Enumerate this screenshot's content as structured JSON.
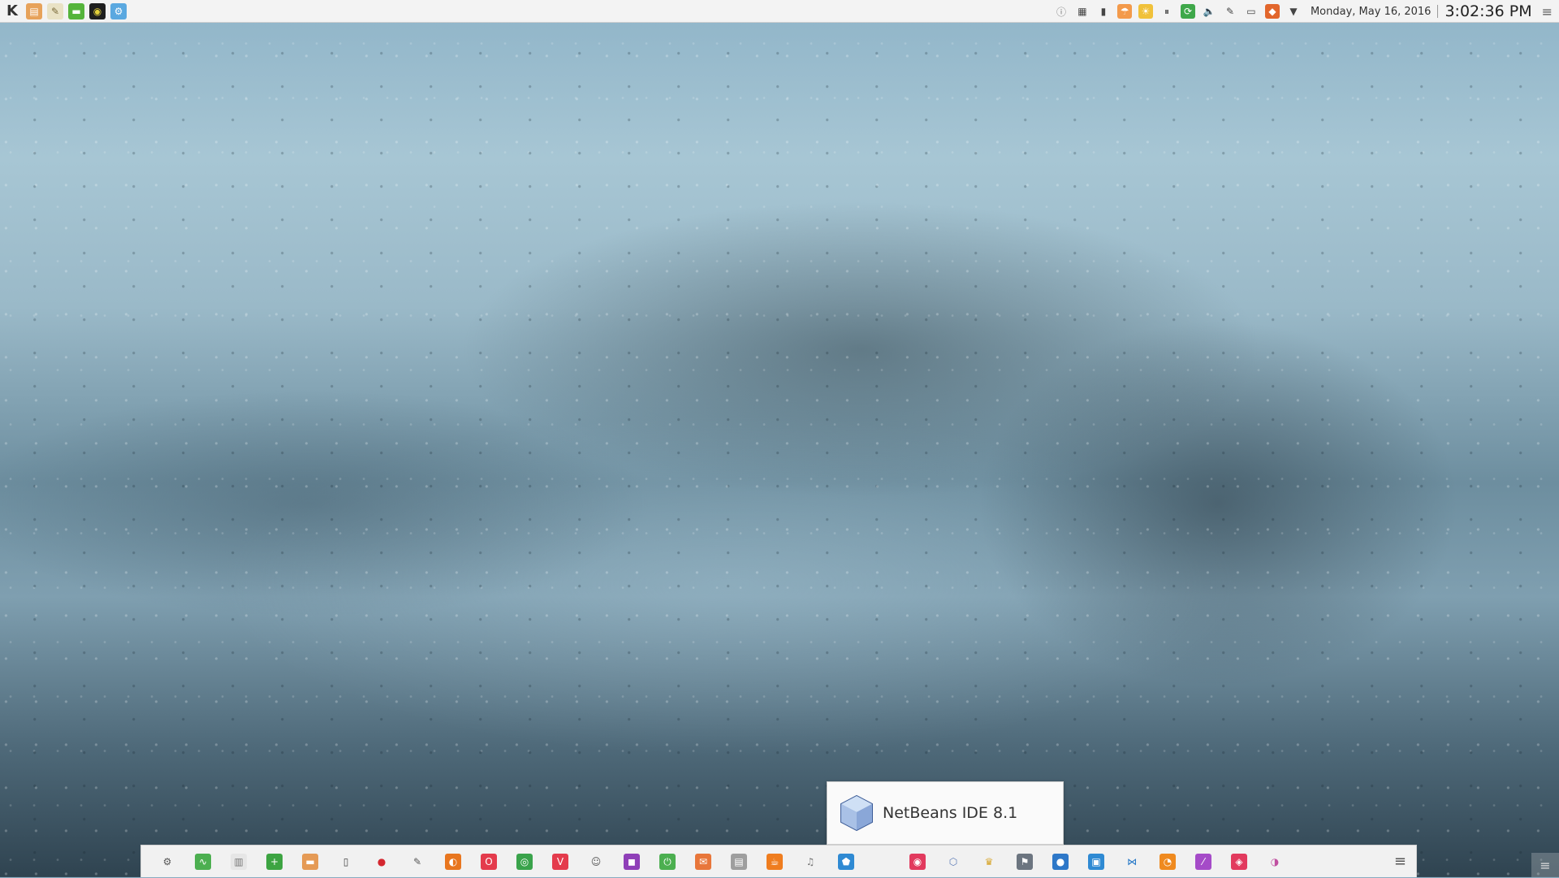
{
  "top_panel": {
    "left_icons": [
      {
        "name": "kde-launcher-icon",
        "glyph": "K",
        "bg": "transparent",
        "fg": "#333333"
      },
      {
        "name": "file-manager-icon",
        "glyph": "▤",
        "bg": "#e7a25a",
        "fg": "#ffffff"
      },
      {
        "name": "notes-icon",
        "glyph": "✎",
        "bg": "#e9e2c5",
        "fg": "#7a6a3a"
      },
      {
        "name": "terminal-icon",
        "glyph": "▬",
        "bg": "#55b43b",
        "fg": "#ffffff"
      },
      {
        "name": "web-browser-icon",
        "glyph": "◉",
        "bg": "#1f1f1f",
        "fg": "#e3d03a"
      },
      {
        "name": "system-settings-icon",
        "glyph": "⚙",
        "bg": "#5aa8e0",
        "fg": "#ffffff"
      }
    ],
    "tray_icons": [
      {
        "name": "info-icon",
        "glyph": "ⓘ",
        "fg": "#777777",
        "bg": "transparent"
      },
      {
        "name": "clipboard-icon",
        "glyph": "▦",
        "fg": "#444444",
        "bg": "transparent"
      },
      {
        "name": "usb-drive-icon",
        "glyph": "▮",
        "fg": "#444444",
        "bg": "transparent"
      },
      {
        "name": "weather-icon",
        "glyph": "☂",
        "fg": "#ffffff",
        "bg": "#f39a4b"
      },
      {
        "name": "sun-cloud-icon",
        "glyph": "☀",
        "fg": "#ffffff",
        "bg": "#f0c13a"
      },
      {
        "name": "media-pause-icon",
        "glyph": "⏸",
        "fg": "#444444",
        "bg": "transparent"
      },
      {
        "name": "update-icon",
        "glyph": "⟳",
        "fg": "#ffffff",
        "bg": "#3fa84a"
      },
      {
        "name": "volume-icon",
        "glyph": "🔈",
        "fg": "#444444",
        "bg": "transparent"
      },
      {
        "name": "pen-icon",
        "glyph": "✎",
        "fg": "#444444",
        "bg": "transparent"
      },
      {
        "name": "display-icon",
        "glyph": "▭",
        "fg": "#444444",
        "bg": "transparent"
      },
      {
        "name": "firewall-icon",
        "glyph": "◆",
        "fg": "#ffffff",
        "bg": "#e2662c"
      },
      {
        "name": "expand-tray-icon",
        "glyph": "▼",
        "fg": "#444444",
        "bg": "transparent"
      }
    ],
    "date": "Monday, May 16, 2016",
    "time": "3:02:36 PM",
    "menu_glyph": "≡"
  },
  "tooltip": {
    "text": "NetBeans IDE 8.1"
  },
  "dock": {
    "items": [
      {
        "name": "settings-icon",
        "glyph": "⚙",
        "bg": "transparent",
        "fg": "#555555"
      },
      {
        "name": "system-monitor-icon",
        "glyph": "∿",
        "bg": "#4caf50",
        "fg": "#ffffff"
      },
      {
        "name": "panel-icon",
        "glyph": "▥",
        "bg": "#e6e6e6",
        "fg": "#777777"
      },
      {
        "name": "spreadsheet-icon",
        "glyph": "+",
        "bg": "#3da442",
        "fg": "#ffffff"
      },
      {
        "name": "folder-icon",
        "glyph": "▬",
        "bg": "#e59a55",
        "fg": "#ffffff"
      },
      {
        "name": "text-document-icon",
        "glyph": "▯",
        "bg": "transparent",
        "fg": "#444444"
      },
      {
        "name": "cherry-icon",
        "glyph": "●",
        "bg": "transparent",
        "fg": "#d4272f"
      },
      {
        "name": "text-editor-icon",
        "glyph": "✎",
        "bg": "transparent",
        "fg": "#555555"
      },
      {
        "name": "firefox-icon",
        "glyph": "◐",
        "bg": "#e8761f",
        "fg": "#ffffff"
      },
      {
        "name": "opera-icon",
        "glyph": "O",
        "bg": "#e43b4c",
        "fg": "#ffffff"
      },
      {
        "name": "chrome-icon",
        "glyph": "◎",
        "bg": "#3aa34b",
        "fg": "#ffffff"
      },
      {
        "name": "vivaldi-icon",
        "glyph": "V",
        "bg": "#e43b4c",
        "fg": "#ffffff"
      },
      {
        "name": "pidgin-icon",
        "glyph": "☺",
        "bg": "transparent",
        "fg": "#555555"
      },
      {
        "name": "chat-icon",
        "glyph": "◼",
        "bg": "#8f3fb8",
        "fg": "#ffffff"
      },
      {
        "name": "power-icon",
        "glyph": "⏻",
        "bg": "#4caf50",
        "fg": "#ffffff"
      },
      {
        "name": "mail-icon",
        "glyph": "✉",
        "bg": "#e8763a",
        "fg": "#ffffff"
      },
      {
        "name": "archive-icon",
        "glyph": "▤",
        "bg": "#9e9e9e",
        "fg": "#ffffff"
      },
      {
        "name": "java-icon",
        "glyph": "☕",
        "bg": "#ef7d1f",
        "fg": "#ffffff"
      },
      {
        "name": "music-icon",
        "glyph": "♫",
        "bg": "transparent",
        "fg": "#777777"
      },
      {
        "name": "shield-icon",
        "glyph": "⬟",
        "bg": "#2f8ad3",
        "fg": "#ffffff"
      },
      {
        "name": "spacer-a",
        "glyph": "",
        "bg": "transparent",
        "fg": "#ffffff"
      },
      {
        "name": "screenshot-icon",
        "glyph": "◉",
        "bg": "#e23a5e",
        "fg": "#ffffff"
      },
      {
        "name": "netbeans-icon",
        "glyph": "⬡",
        "bg": "transparent",
        "fg": "#5a79b5"
      },
      {
        "name": "game-icon",
        "glyph": "♛",
        "bg": "transparent",
        "fg": "#d7a52a"
      },
      {
        "name": "bookmark-icon",
        "glyph": "⚑",
        "bg": "#6c7580",
        "fg": "#ffffff"
      },
      {
        "name": "globe-icon",
        "glyph": "●",
        "bg": "#2e78c8",
        "fg": "#ffffff"
      },
      {
        "name": "window-icon",
        "glyph": "▣",
        "bg": "#2f8ad3",
        "fg": "#ffffff"
      },
      {
        "name": "vscode-icon",
        "glyph": "⋈",
        "bg": "transparent",
        "fg": "#1f74c6"
      },
      {
        "name": "blender-icon",
        "glyph": "◔",
        "bg": "#ef8a1f",
        "fg": "#ffffff"
      },
      {
        "name": "brush-icon",
        "glyph": "⁄",
        "bg": "#a54bc8",
        "fg": "#ffffff"
      },
      {
        "name": "photo-icon",
        "glyph": "◈",
        "bg": "#e23a5e",
        "fg": "#ffffff"
      },
      {
        "name": "color-picker-icon",
        "glyph": "◑",
        "bg": "transparent",
        "fg": "#c04fa0"
      }
    ],
    "menu_glyph": "≡"
  },
  "corner_button_glyph": "≡"
}
